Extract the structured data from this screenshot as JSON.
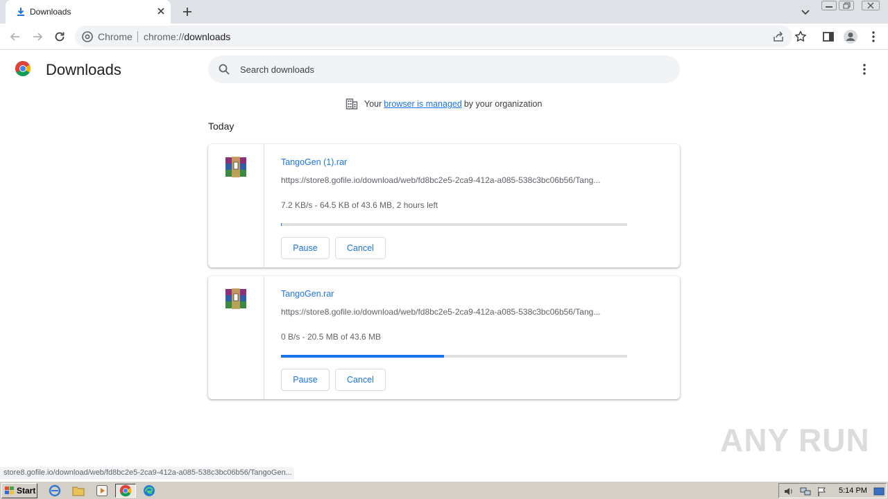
{
  "browser": {
    "tab": {
      "title": "Downloads"
    },
    "omnibox": {
      "site_label": "Chrome",
      "url_scheme": "chrome://",
      "url_path": "downloads"
    }
  },
  "page": {
    "title": "Downloads",
    "search": {
      "placeholder": "Search downloads"
    },
    "managed_notice": {
      "before": "Your",
      "link": "browser is managed",
      "after": "by your organization"
    },
    "section_label": "Today",
    "downloads": [
      {
        "file_name": "TangoGen (1).rar",
        "url": "https://store8.gofile.io/download/web/fd8bc2e5-2ca9-412a-a085-538c3bc06b56/Tang...",
        "status": "7.2 KB/s - 64.5 KB of 43.6 MB, 2 hours left",
        "progress_fraction": 0.0015,
        "pause_label": "Pause",
        "cancel_label": "Cancel"
      },
      {
        "file_name": "TangoGen.rar",
        "url": "https://store8.gofile.io/download/web/fd8bc2e5-2ca9-412a-a085-538c3bc06b56/Tang...",
        "status": "0 B/s - 20.5 MB of 43.6 MB",
        "progress_fraction": 0.47,
        "pause_label": "Pause",
        "cancel_label": "Cancel"
      }
    ]
  },
  "status_bar": {
    "text": "store8.gofile.io/download/web/fd8bc2e5-2ca9-412a-a085-538c3bc06b56/TangoGen..."
  },
  "watermark": {
    "text": "ANY RUN"
  },
  "taskbar": {
    "start_label": "Start",
    "clock": "5:14 PM"
  },
  "colors": {
    "accent": "#1a73e8",
    "progress_track": "#e0e0e0",
    "taskbar": "#d4d0c8"
  }
}
